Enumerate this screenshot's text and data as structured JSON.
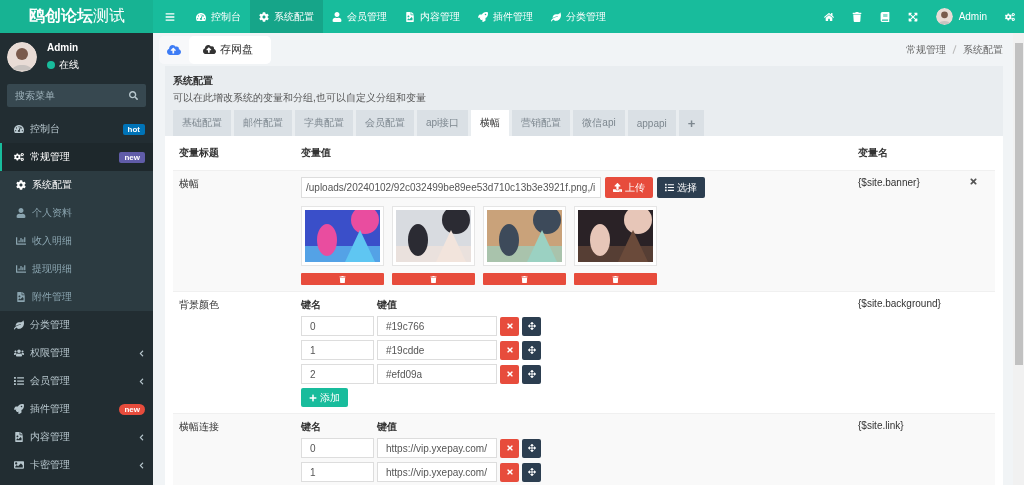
{
  "brand": {
    "name": "鸥创论坛",
    "suffix": "测试"
  },
  "top_nav": [
    {
      "label": "控制台",
      "selected": false
    },
    {
      "label": "系统配置",
      "selected": true
    },
    {
      "label": "会员管理",
      "selected": false
    },
    {
      "label": "内容管理",
      "selected": false
    },
    {
      "label": "插件管理",
      "selected": false
    },
    {
      "label": "分类管理",
      "selected": false
    }
  ],
  "top_user": {
    "name": "Admin"
  },
  "sidebar": {
    "user": {
      "name": "Admin",
      "status": "在线"
    },
    "search": {
      "placeholder": "搜索菜单"
    },
    "items": [
      {
        "label": "控制台",
        "selected": false,
        "badge": {
          "text": "hot",
          "kind": "label",
          "color": "#0073b7"
        }
      },
      {
        "label": "常规管理",
        "selected": true,
        "expanded": true,
        "badge": {
          "text": "new",
          "kind": "label",
          "color": "#605ca8"
        },
        "children": [
          {
            "label": "系统配置",
            "selected": true
          },
          {
            "label": "个人资料",
            "selected": false
          },
          {
            "label": "收入明细",
            "selected": false
          },
          {
            "label": "提现明细",
            "selected": false
          },
          {
            "label": "附件管理",
            "selected": false
          }
        ]
      },
      {
        "label": "分类管理",
        "selected": false
      },
      {
        "label": "权限管理",
        "selected": false,
        "expanded": false
      },
      {
        "label": "会员管理",
        "selected": false,
        "expanded": false
      },
      {
        "label": "插件管理",
        "selected": false,
        "badge": {
          "text": "new",
          "kind": "pill",
          "color": "#e74c3c"
        }
      },
      {
        "label": "内容管理",
        "selected": false,
        "expanded": false
      },
      {
        "label": "卡密管理",
        "selected": false,
        "expanded": false
      }
    ]
  },
  "cloud_widget": {
    "label": "存网盘"
  },
  "breadcrumb": [
    "常规管理",
    "系统配置"
  ],
  "panel": {
    "title": "系统配置",
    "description": "可以在此增改系统的变量和分组,也可以自定义分组和变量",
    "tabs": [
      {
        "label": "基础配置",
        "selected": false
      },
      {
        "label": "邮件配置",
        "selected": false
      },
      {
        "label": "字典配置",
        "selected": false
      },
      {
        "label": "会员配置",
        "selected": false
      },
      {
        "label": "api接口",
        "selected": false
      },
      {
        "label": "横幅",
        "selected": true
      },
      {
        "label": "营销配置",
        "selected": false
      },
      {
        "label": "微信api",
        "selected": false
      },
      {
        "label": "appapi",
        "selected": false
      },
      {
        "label": "+",
        "selected": false
      }
    ],
    "table": {
      "columns": [
        "变量标题",
        "变量值",
        "变量名"
      ],
      "rows": [
        {
          "kind": "images",
          "title": "横幅",
          "value": "/uploads/20240102/92c032499be89ee53d710c13b3e3921f.png,/i",
          "upload": "上传",
          "choose": "选择",
          "name": "{$site.banner}",
          "removable": true
        },
        {
          "kind": "keyvalue",
          "title": "背景颜色",
          "key_header": "键名",
          "value_header": "键值",
          "pairs": [
            {
              "key": "0",
              "value": "#19c766"
            },
            {
              "key": "1",
              "value": "#19cdde"
            },
            {
              "key": "2",
              "value": "#efd09a"
            }
          ],
          "add": "添加",
          "name": "{$site.background}"
        },
        {
          "kind": "keyvalue",
          "title": "横幅连接",
          "key_header": "键名",
          "value_header": "键值",
          "pairs": [
            {
              "key": "0",
              "value": "https://vip.yxepay.com/"
            },
            {
              "key": "1",
              "value": "https://vip.yxepay.com/"
            }
          ],
          "name": "{$site.link}"
        }
      ]
    }
  }
}
